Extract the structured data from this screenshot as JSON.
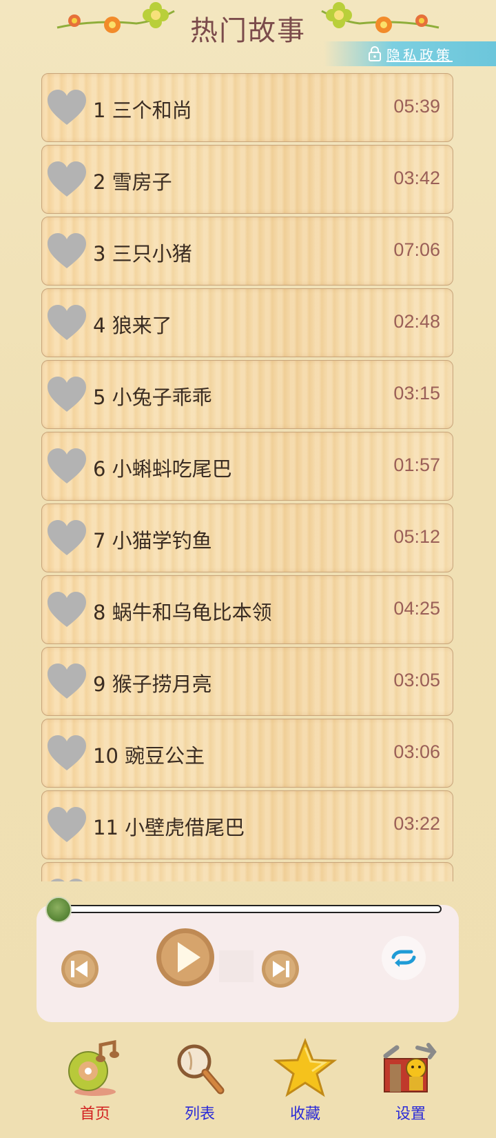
{
  "header": {
    "title": "热门故事",
    "privacy_label": "隐私政策"
  },
  "stories": [
    {
      "index": "1",
      "title": "三个和尚",
      "duration": "05:39"
    },
    {
      "index": "2",
      "title": "雪房子",
      "duration": "03:42"
    },
    {
      "index": "3",
      "title": "三只小猪",
      "duration": "07:06"
    },
    {
      "index": "4",
      "title": "狼来了",
      "duration": "02:48"
    },
    {
      "index": "5",
      "title": "小兔子乖乖",
      "duration": "03:15"
    },
    {
      "index": "6",
      "title": "小蝌蚪吃尾巴",
      "duration": "01:57"
    },
    {
      "index": "7",
      "title": "小猫学钓鱼",
      "duration": "05:12"
    },
    {
      "index": "8",
      "title": "蜗牛和乌龟比本领",
      "duration": "04:25"
    },
    {
      "index": "9",
      "title": "猴子捞月亮",
      "duration": "03:05"
    },
    {
      "index": "10",
      "title": "豌豆公主",
      "duration": "03:06"
    },
    {
      "index": "11",
      "title": "小壁虎借尾巴",
      "duration": "03:22"
    },
    {
      "index": "",
      "title": "",
      "duration": ""
    }
  ],
  "player": {
    "progress": 0,
    "controls": [
      "prev-icon",
      "play-icon",
      "next-icon",
      "repeat-icon"
    ]
  },
  "nav": {
    "tabs": [
      {
        "label": "首页",
        "icon": "home-music-icon",
        "color": "#d22020",
        "active": true
      },
      {
        "label": "列表",
        "icon": "magnifier-icon",
        "color": "#2a2ad8",
        "active": false
      },
      {
        "label": "收藏",
        "icon": "star-icon",
        "color": "#2a2ad8",
        "active": false
      },
      {
        "label": "设置",
        "icon": "settings-toolbox-icon",
        "color": "#2a2ad8",
        "active": false
      }
    ]
  },
  "colors": {
    "accent_privacy": "#7ccfe0",
    "title": "#7b4b4b",
    "duration": "#9a5f58"
  }
}
